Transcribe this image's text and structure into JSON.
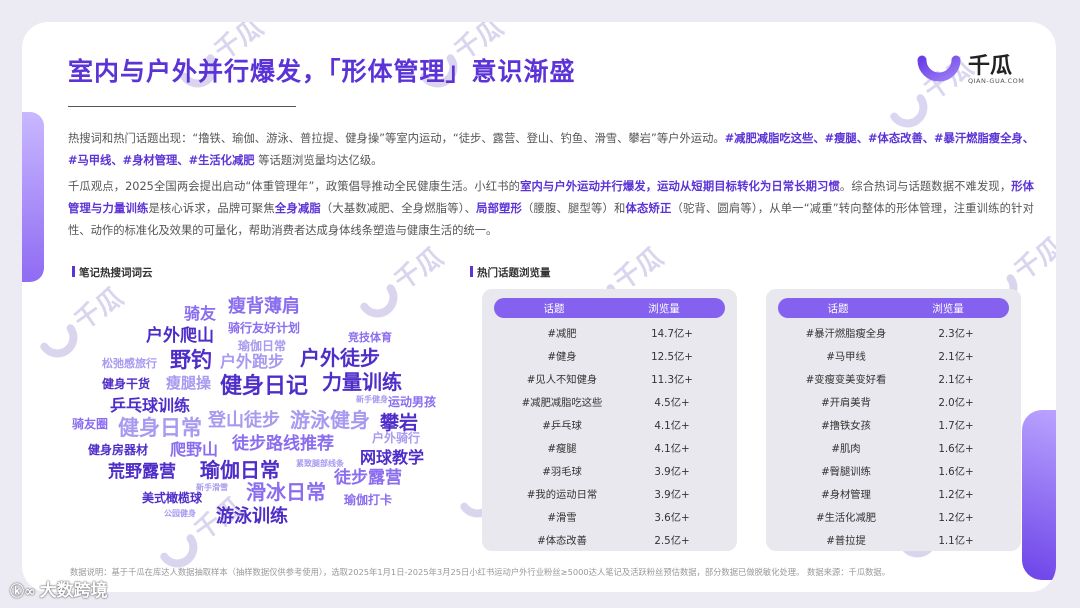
{
  "title": "室内与户外并行爆发，「形体管理」意识渐盛",
  "logo": {
    "name": "千瓜",
    "sub": "QIAN-GUA.COM"
  },
  "paragraph1": {
    "a": "热搜词和热门话题出现：“撸铁、瑜伽、游泳、普拉提、健身操”等室内运动，“徒步、露营、登山、钓鱼、滑雪、攀岩”等户外运动。",
    "b": "#减肥减脂吃这些、#瘦腿、#体态改善、#暴汗燃脂瘦全身、#马甲线、#身材管理、#生活化减肥",
    "c": " 等话题浏览量均达亿级。"
  },
  "paragraph2": {
    "a": "千瓜观点，2025全国两会提出启动“体重管理年”，政策倡导推动全民健康生活。小红书的",
    "b": "室内与户外运动并行爆发，运动从短期目标转化为日常长期习惯",
    "c": "。综合热词与话题数据不难发现，",
    "d": "形体管理与力量训练",
    "e": "是核心诉求，品牌可聚焦",
    "f": "全身减脂",
    "g": "（大基数减肥、全身燃脂等）、",
    "h": "局部塑形",
    "i": "（腰腹、腿型等）和",
    "j": "体态矫正",
    "k": "（驼背、圆肩等），从单一“减重”转向整体的形体管理，注重训练的针对性、动作的标准化及效果的可量化，帮助消费者达成身体线条塑造与健康生活的统一。"
  },
  "cloud_label": "笔记热搜词词云",
  "topics_label": "热门话题浏览量",
  "word_cloud": [
    {
      "text": "骑友",
      "color": "#8b6df0",
      "size": 16
    },
    {
      "text": "瘦背薄肩",
      "color": "#8b6df0",
      "size": 18
    },
    {
      "text": "骑行友好计划",
      "color": "#8b6df0",
      "size": 12
    },
    {
      "text": "户外爬山",
      "color": "#4f2dc9",
      "size": 17
    },
    {
      "text": "竞技体育",
      "color": "#8b6df0",
      "size": 11
    },
    {
      "text": "瑜伽日常",
      "color": "#a89af0",
      "size": 12
    },
    {
      "text": "野钓",
      "color": "#4f2dc9",
      "size": 21
    },
    {
      "text": "户外跑步",
      "color": "#a89af0",
      "size": 16
    },
    {
      "text": "户外徒步",
      "color": "#4f2dc9",
      "size": 20
    },
    {
      "text": "松弛感旅行",
      "color": "#a89af0",
      "size": 11
    },
    {
      "text": "健身干货",
      "color": "#4f2dc9",
      "size": 12
    },
    {
      "text": "瘦腿操",
      "color": "#a89af0",
      "size": 15
    },
    {
      "text": "健身日记",
      "color": "#4f2dc9",
      "size": 22
    },
    {
      "text": "力量训练",
      "color": "#4f2dc9",
      "size": 20
    },
    {
      "text": "新手健身",
      "color": "#a89af0",
      "size": 8
    },
    {
      "text": "乒乓球训练",
      "color": "#4f2dc9",
      "size": 16
    },
    {
      "text": "运动男孩",
      "color": "#8b6df0",
      "size": 12
    },
    {
      "text": "骑友圈",
      "color": "#8b6df0",
      "size": 12
    },
    {
      "text": "健身日常",
      "color": "#a89af0",
      "size": 21
    },
    {
      "text": "登山徒步",
      "color": "#a89af0",
      "size": 18
    },
    {
      "text": "游泳健身",
      "color": "#a89af0",
      "size": 20
    },
    {
      "text": "攀岩",
      "color": "#4f2dc9",
      "size": 19
    },
    {
      "text": "户外骑行",
      "color": "#a89af0",
      "size": 12
    },
    {
      "text": "健身房器材",
      "color": "#4f2dc9",
      "size": 12
    },
    {
      "text": "爬野山",
      "color": "#8b6df0",
      "size": 16
    },
    {
      "text": "徒步路线推荐",
      "color": "#8b6df0",
      "size": 17
    },
    {
      "text": "网球教学",
      "color": "#4f2dc9",
      "size": 16
    },
    {
      "text": "紧致腿部线条",
      "color": "#a89af0",
      "size": 8
    },
    {
      "text": "荒野露营",
      "color": "#4f2dc9",
      "size": 17
    },
    {
      "text": "瑜伽日常",
      "color": "#4f2dc9",
      "size": 20
    },
    {
      "text": "徒步露营",
      "color": "#8b6df0",
      "size": 17
    },
    {
      "text": "新手滑雪",
      "color": "#a89af0",
      "size": 8
    },
    {
      "text": "美式橄榄球",
      "color": "#4f2dc9",
      "size": 12
    },
    {
      "text": "滑冰日常",
      "color": "#8b6df0",
      "size": 20
    },
    {
      "text": "瑜伽打卡",
      "color": "#8b6df0",
      "size": 12
    },
    {
      "text": "公园健身",
      "color": "#a89af0",
      "size": 8
    },
    {
      "text": "游泳训练",
      "color": "#4f2dc9",
      "size": 18
    }
  ],
  "table_headers": {
    "topic": "话题",
    "views": "浏览量"
  },
  "topics_left": [
    {
      "topic": "#减肥",
      "views": "14.7亿+"
    },
    {
      "topic": "#健身",
      "views": "12.5亿+"
    },
    {
      "topic": "#见人不知健身",
      "views": "11.3亿+"
    },
    {
      "topic": "#减肥减脂吃这些",
      "views": "4.5亿+"
    },
    {
      "topic": "#乒乓球",
      "views": "4.1亿+"
    },
    {
      "topic": "#瘦腿",
      "views": "4.1亿+"
    },
    {
      "topic": "#羽毛球",
      "views": "3.9亿+"
    },
    {
      "topic": "#我的运动日常",
      "views": "3.9亿+"
    },
    {
      "topic": "#滑雪",
      "views": "3.6亿+"
    },
    {
      "topic": "#体态改善",
      "views": "2.5亿+"
    }
  ],
  "topics_right": [
    {
      "topic": "#暴汗燃脂瘦全身",
      "views": "2.3亿+"
    },
    {
      "topic": "#马甲线",
      "views": "2.1亿+"
    },
    {
      "topic": "#变瘦变美变好看",
      "views": "2.1亿+"
    },
    {
      "topic": "#开肩美背",
      "views": "2.0亿+"
    },
    {
      "topic": "#撸铁女孩",
      "views": "1.7亿+"
    },
    {
      "topic": "#肌肉",
      "views": "1.6亿+"
    },
    {
      "topic": "#臀腿训练",
      "views": "1.6亿+"
    },
    {
      "topic": "#身材管理",
      "views": "1.2亿+"
    },
    {
      "topic": "#生活化减肥",
      "views": "1.2亿+"
    },
    {
      "topic": "#普拉提",
      "views": "1.1亿+"
    }
  ],
  "footnote": "数据说明：基于千瓜在库达人数据抽取样本（抽样数据仅供参考使用），选取2025年1月1日-2025年3月25日小红书运动户外行业粉丝≥5000达人笔记及活跃粉丝预估数据，部分数据已做脱敏化处理。 数据来源：千瓜数据。",
  "brand_watermark": "大数跨境",
  "brand_mark": "ⓚ∞",
  "watermark_text": "千瓜",
  "colors": {
    "accent": "#5b33d6",
    "table_head": "#8462ef",
    "table_bg": "#e8e8ee"
  }
}
